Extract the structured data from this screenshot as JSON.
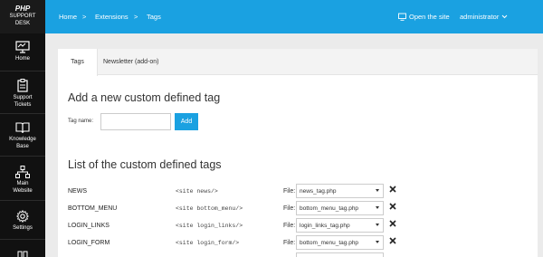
{
  "brand": {
    "line1": "PHP",
    "line2": "SUPPORT",
    "line3": "DESK"
  },
  "sidebar": {
    "items": [
      {
        "label": "Home",
        "icon": "monitor-icon"
      },
      {
        "label": "Support\nTickets",
        "icon": "clipboard-icon"
      },
      {
        "label": "Knowledge\nBase",
        "icon": "book-icon"
      },
      {
        "label": "Main\nWebsite",
        "icon": "sitemap-icon"
      },
      {
        "label": "Settings",
        "icon": "gear-icon"
      }
    ]
  },
  "topbar": {
    "breadcrumb": [
      "Home",
      "Extensions",
      "Tags"
    ],
    "separator": ">",
    "open_site": "Open the site",
    "user": "administrator"
  },
  "tabs": [
    {
      "label": "Tags",
      "active": true
    },
    {
      "label": "Newsletter (add-on)",
      "active": false
    }
  ],
  "add_section": {
    "heading": "Add a new custom defined tag",
    "tag_name_label": "Tag name:",
    "tag_name_value": "",
    "add_button": "Add"
  },
  "list_section": {
    "heading": "List of the custom defined tags",
    "file_label": "File:",
    "rows": [
      {
        "name": "NEWS",
        "code": "<site news/>",
        "file": "news_tag.php"
      },
      {
        "name": "BOTTOM_MENU",
        "code": "<site bottom_menu/>",
        "file": "bottom_menu_tag.php"
      },
      {
        "name": "LOGIN_LINKS",
        "code": "<site login_links/>",
        "file": "login_links_tag.php"
      },
      {
        "name": "LOGIN_FORM",
        "code": "<site login_form/>",
        "file": "bottom_menu_tag.php"
      }
    ]
  },
  "colors": {
    "accent": "#1aa1e1",
    "sidebar": "#111111",
    "page_bg": "#ebebeb"
  }
}
